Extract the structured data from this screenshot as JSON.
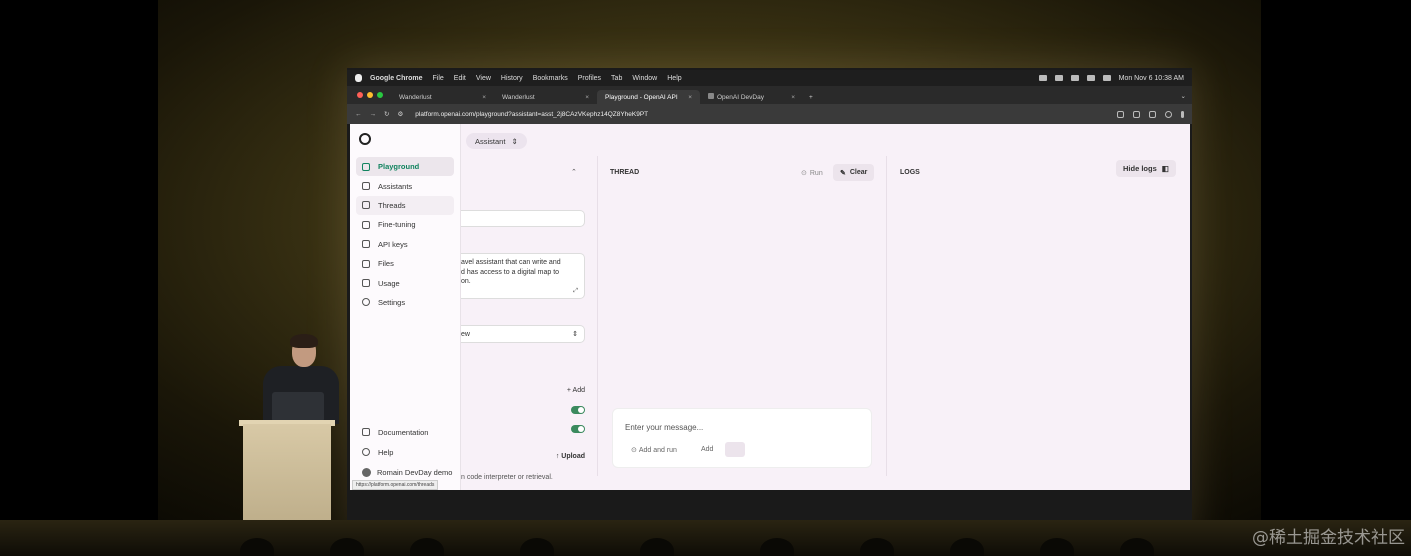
{
  "menubar": {
    "items": [
      "Google Chrome",
      "File",
      "Edit",
      "View",
      "History",
      "Bookmarks",
      "Profiles",
      "Tab",
      "Window",
      "Help"
    ],
    "clock": "Mon Nov 6  10:38 AM"
  },
  "tabs": [
    {
      "label": "Wanderlust"
    },
    {
      "label": "Wanderlust"
    },
    {
      "label": "Playground - OpenAI API"
    },
    {
      "label": "OpenAI DevDay"
    }
  ],
  "addressbar": {
    "url": "platform.openai.com/playground?assistant=asst_2j8CAzVKephz14QZ8YheK9PT"
  },
  "sidebar": {
    "items": [
      {
        "label": "Playground",
        "icon": "terminal-icon"
      },
      {
        "label": "Assistants",
        "icon": "people-icon"
      },
      {
        "label": "Threads",
        "icon": "threads-icon"
      },
      {
        "label": "Fine-tuning",
        "icon": "sliders-icon"
      },
      {
        "label": "API keys",
        "icon": "lock-icon"
      },
      {
        "label": "Files",
        "icon": "folder-icon"
      },
      {
        "label": "Usage",
        "icon": "bar-chart-icon"
      },
      {
        "label": "Settings",
        "icon": "gear-icon"
      }
    ],
    "bottom": [
      {
        "label": "Documentation",
        "icon": "book-icon"
      },
      {
        "label": "Help",
        "icon": "help-icon"
      },
      {
        "label": "Romain DevDay demo",
        "icon": "avatar-icon"
      }
    ],
    "status_url": "https://platform.openai.com/threads"
  },
  "assistant_mode": "Assistant",
  "config_panel": {
    "instructions_visible": [
      "avel assistant that can write and",
      "d has access to a digital map to",
      "on."
    ],
    "model_partial": "ew",
    "tools_add": "+ Add",
    "upload": "Upload",
    "note_partial": "n code interpreter or retrieval."
  },
  "thread": {
    "title": "THREAD",
    "run_label": "Run",
    "clear_label": "Clear",
    "composer_placeholder": "Enter your message...",
    "add_and_run": "Add and run",
    "add": "Add"
  },
  "logs": {
    "title": "LOGS",
    "hide_label": "Hide logs"
  },
  "watermark": "@稀土掘金技术社区"
}
